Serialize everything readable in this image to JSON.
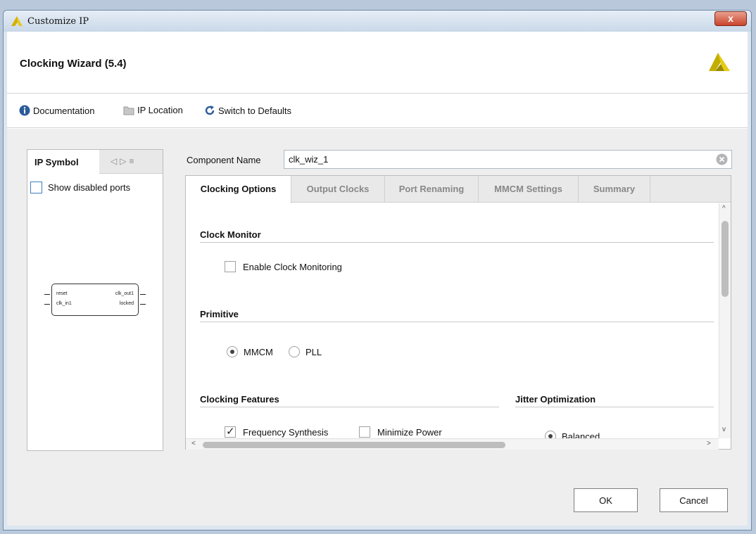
{
  "window": {
    "title": "Customize IP",
    "close_glyph": "x"
  },
  "header": {
    "title": "Clocking Wizard (5.4)",
    "logo_icon": "xilinx-logo"
  },
  "toolbar": {
    "documentation": "Documentation",
    "ip_location": "IP Location",
    "switch_defaults": "Switch to Defaults"
  },
  "left_panel": {
    "tab_label": "IP Symbol",
    "show_disabled_ports": "Show disabled ports",
    "symbol": {
      "inputs": [
        "reset",
        "clk_in1"
      ],
      "outputs": [
        "clk_out1",
        "locked"
      ]
    }
  },
  "component": {
    "label": "Component Name",
    "value": "clk_wiz_1"
  },
  "tabs": [
    {
      "label": "Clocking Options",
      "active": true
    },
    {
      "label": "Output Clocks",
      "active": false
    },
    {
      "label": "Port Renaming",
      "active": false
    },
    {
      "label": "MMCM Settings",
      "active": false
    },
    {
      "label": "Summary",
      "active": false
    }
  ],
  "clocking_options": {
    "clock_monitor": {
      "title": "Clock Monitor",
      "enable_label": "Enable Clock Monitoring",
      "enabled": false
    },
    "primitive": {
      "title": "Primitive",
      "options": [
        "MMCM",
        "PLL"
      ],
      "selected": "MMCM"
    },
    "clocking_features": {
      "title": "Clocking Features",
      "frequency_synthesis": "Frequency Synthesis",
      "frequency_synthesis_checked": true,
      "minimize_power": "Minimize Power",
      "minimize_power_checked": false
    },
    "jitter_optimization": {
      "title": "Jitter Optimization",
      "balanced": "Balanced"
    }
  },
  "footer": {
    "ok": "OK",
    "cancel": "Cancel"
  },
  "colors": {
    "accent": "#3c7fc1",
    "logo": "#c8b400"
  }
}
